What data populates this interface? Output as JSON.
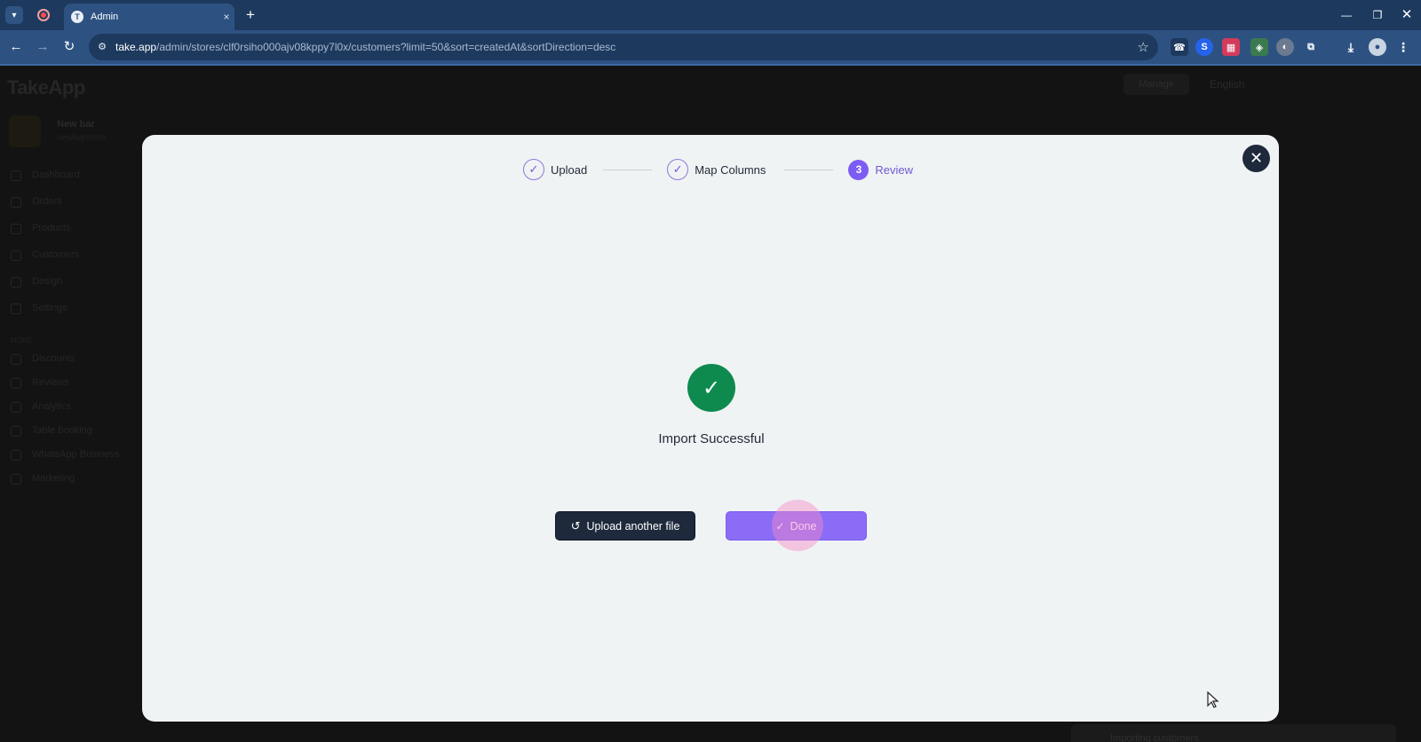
{
  "browser": {
    "tab_title": "Admin",
    "tab_close": "×",
    "new_tab": "+",
    "url_host": "take.app",
    "url_path": "/admin/stores/clf0rsiho000ajv08kppy7l0x/customers?limit=50&sort=createdAt&sortDirection=desc",
    "extensions": [
      {
        "name": "phone-extension-icon",
        "glyph": "☎",
        "color": "#1d3a5e"
      },
      {
        "name": "s-extension-icon",
        "glyph": "S",
        "color": "#2563eb"
      },
      {
        "name": "red-extension-icon",
        "glyph": "▦",
        "color": "#d23b5a"
      },
      {
        "name": "badge-extension-icon",
        "glyph": "◈",
        "color": "#3b7a4f"
      },
      {
        "name": "globe-extension-icon",
        "glyph": "◐",
        "color": "#6b7a8f"
      }
    ]
  },
  "backdrop": {
    "logo": "TakeApp",
    "manage": "Manage",
    "language": "English",
    "store_name": "New bar",
    "store_handle": "newbarmnm",
    "sidebar": [
      "Dashboard",
      "Orders",
      "Products",
      "Customers",
      "Design",
      "Settings",
      "Discounts",
      "Reviews",
      "Analytics",
      "Table booking",
      "WhatsApp Business",
      "Marketing"
    ],
    "section_label": "MORE",
    "toast": "Importing customers"
  },
  "modal": {
    "steps": [
      {
        "label": "Upload",
        "state": "done"
      },
      {
        "label": "Map Columns",
        "state": "done"
      },
      {
        "label": "Review",
        "state": "active",
        "number": "3"
      }
    ],
    "success_text": "Import Successful",
    "upload_another_label": "Upload another file",
    "done_label": "Done"
  },
  "colors": {
    "accent": "#7c5cf3",
    "success": "#0f8a4f",
    "dark_button": "#1e293b"
  }
}
